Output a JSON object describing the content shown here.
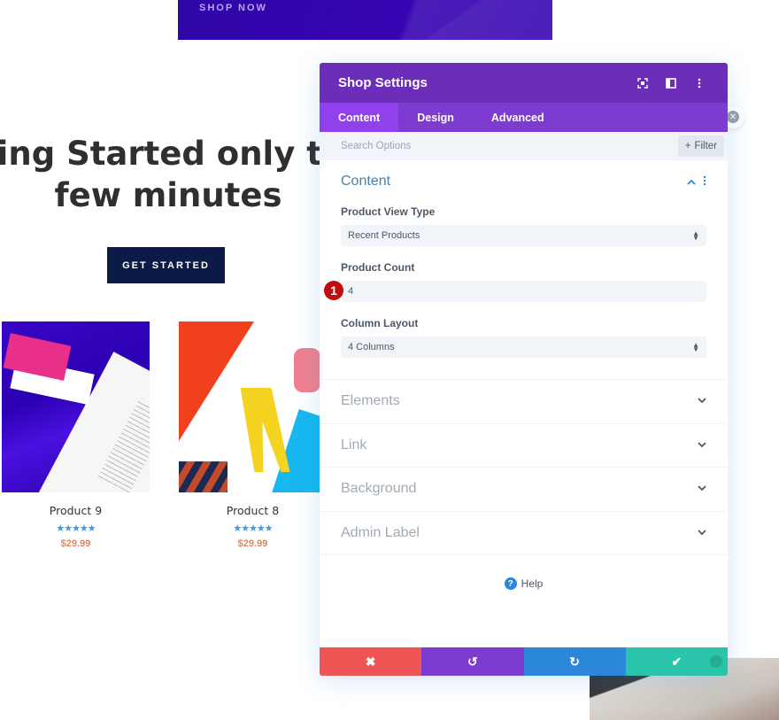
{
  "page": {
    "banner": {
      "label": "SHOP NOW"
    },
    "hero": {
      "line1": "ring Started only tal",
      "line2": "few minutes"
    },
    "cta": {
      "label": "GET STARTED"
    },
    "products": [
      {
        "name": "Product 9",
        "rating": 5,
        "rating_max": 5,
        "stars": "★★★★★",
        "price": "$29.99"
      },
      {
        "name": "Product 8",
        "rating": 5,
        "rating_max": 5,
        "stars": "★★★★★",
        "price": "$29.99"
      }
    ]
  },
  "modal": {
    "title": "Shop Settings",
    "header_icons": [
      "expand-icon",
      "split-view-icon",
      "more-options-icon"
    ],
    "tabs": [
      {
        "label": "Content",
        "active": true
      },
      {
        "label": "Design",
        "active": false
      },
      {
        "label": "Advanced",
        "active": false
      }
    ],
    "search": {
      "placeholder": "Search Options",
      "value": ""
    },
    "filter": {
      "label": "Filter",
      "icon": "+"
    },
    "content_section": {
      "title": "Content",
      "fields": [
        {
          "label": "Product View Type",
          "type": "select",
          "value": "Recent Products"
        },
        {
          "label": "Product Count",
          "type": "text",
          "value": "4",
          "badge": "1"
        },
        {
          "label": "Column Layout",
          "type": "select",
          "value": "4 Columns"
        }
      ]
    },
    "collapsed_sections": [
      {
        "title": "Elements"
      },
      {
        "title": "Link"
      },
      {
        "title": "Background"
      },
      {
        "title": "Admin Label"
      }
    ],
    "help": {
      "label": "Help",
      "icon": "?"
    },
    "footer": {
      "discard_icon": "✖",
      "undo_icon": "↺",
      "redo_icon": "↻",
      "save_icon": "✔"
    },
    "colors": {
      "header": "#6c2eb9",
      "tabs": "#7e3bd0",
      "active_tab": "#8f42ec",
      "discard": "#ef5555",
      "undo": "#7d3bcf",
      "redo": "#2b87da",
      "save": "#29c4a9"
    }
  }
}
